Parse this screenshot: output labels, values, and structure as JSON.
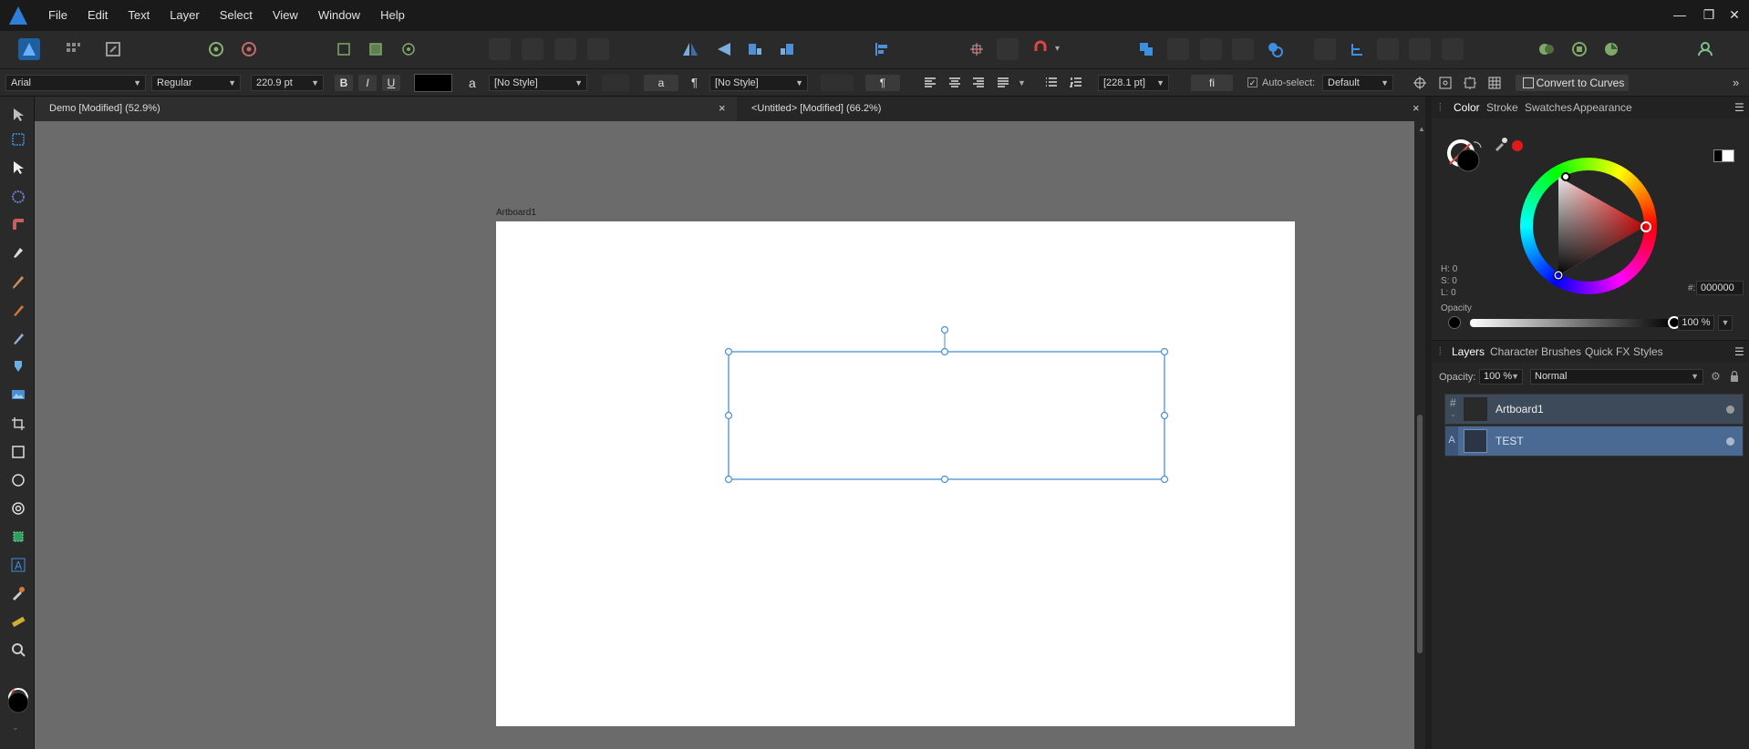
{
  "menubar": {
    "items": [
      "File",
      "Edit",
      "Text",
      "Layer",
      "Select",
      "View",
      "Window",
      "Help"
    ],
    "window_controls": {
      "minimize": "—",
      "restore": "❐",
      "close": "✕"
    }
  },
  "context_toolbar": {
    "font_family": "Arial",
    "font_style": "Regular",
    "font_size": "220.9 pt",
    "bold": "B",
    "italic": "I",
    "underline": "U",
    "text_color": "#000000",
    "char_style_icon": "a",
    "char_style": "[No Style]",
    "case_icon": "a",
    "para_icon": "¶",
    "para_style": "[No Style]",
    "para_mark": "¶",
    "leading": "[228.1 pt]",
    "ligature": "fi",
    "auto_select_label": "Auto-select:",
    "auto_select_value": "Default",
    "convert_button": "Convert to Curves",
    "overflow": "»"
  },
  "documents": {
    "tabs": [
      {
        "title": "Demo [Modified] (52.9%)"
      },
      {
        "title": "<Untitled> [Modified] (66.2%)"
      }
    ],
    "close_glyph": "×"
  },
  "artboard": {
    "label": "Artboard1"
  },
  "color_panel": {
    "tabs": [
      "Color",
      "Stroke",
      "Swatches",
      "Appearance"
    ],
    "h": "H: 0",
    "s": "S: 0",
    "l": "L: 0",
    "hex_label": "#:",
    "hex_value": "000000",
    "opacity_label": "Opacity",
    "opacity_value": "100 %",
    "opacity_fraction": 1.0
  },
  "layers_panel": {
    "tabs": [
      "Layers",
      "Character",
      "Brushes",
      "Quick FX",
      "Styles"
    ],
    "opacity_label": "Opacity:",
    "opacity_value": "100 %",
    "blend_mode": "Normal",
    "layers": [
      {
        "name": "Artboard1",
        "type_icon": "#"
      },
      {
        "name": "TEST",
        "type_icon": "A"
      }
    ]
  },
  "colors": {
    "accent": "#3d8fe0",
    "selection": "#4a90d9",
    "selected_row": "#4a6a93"
  }
}
